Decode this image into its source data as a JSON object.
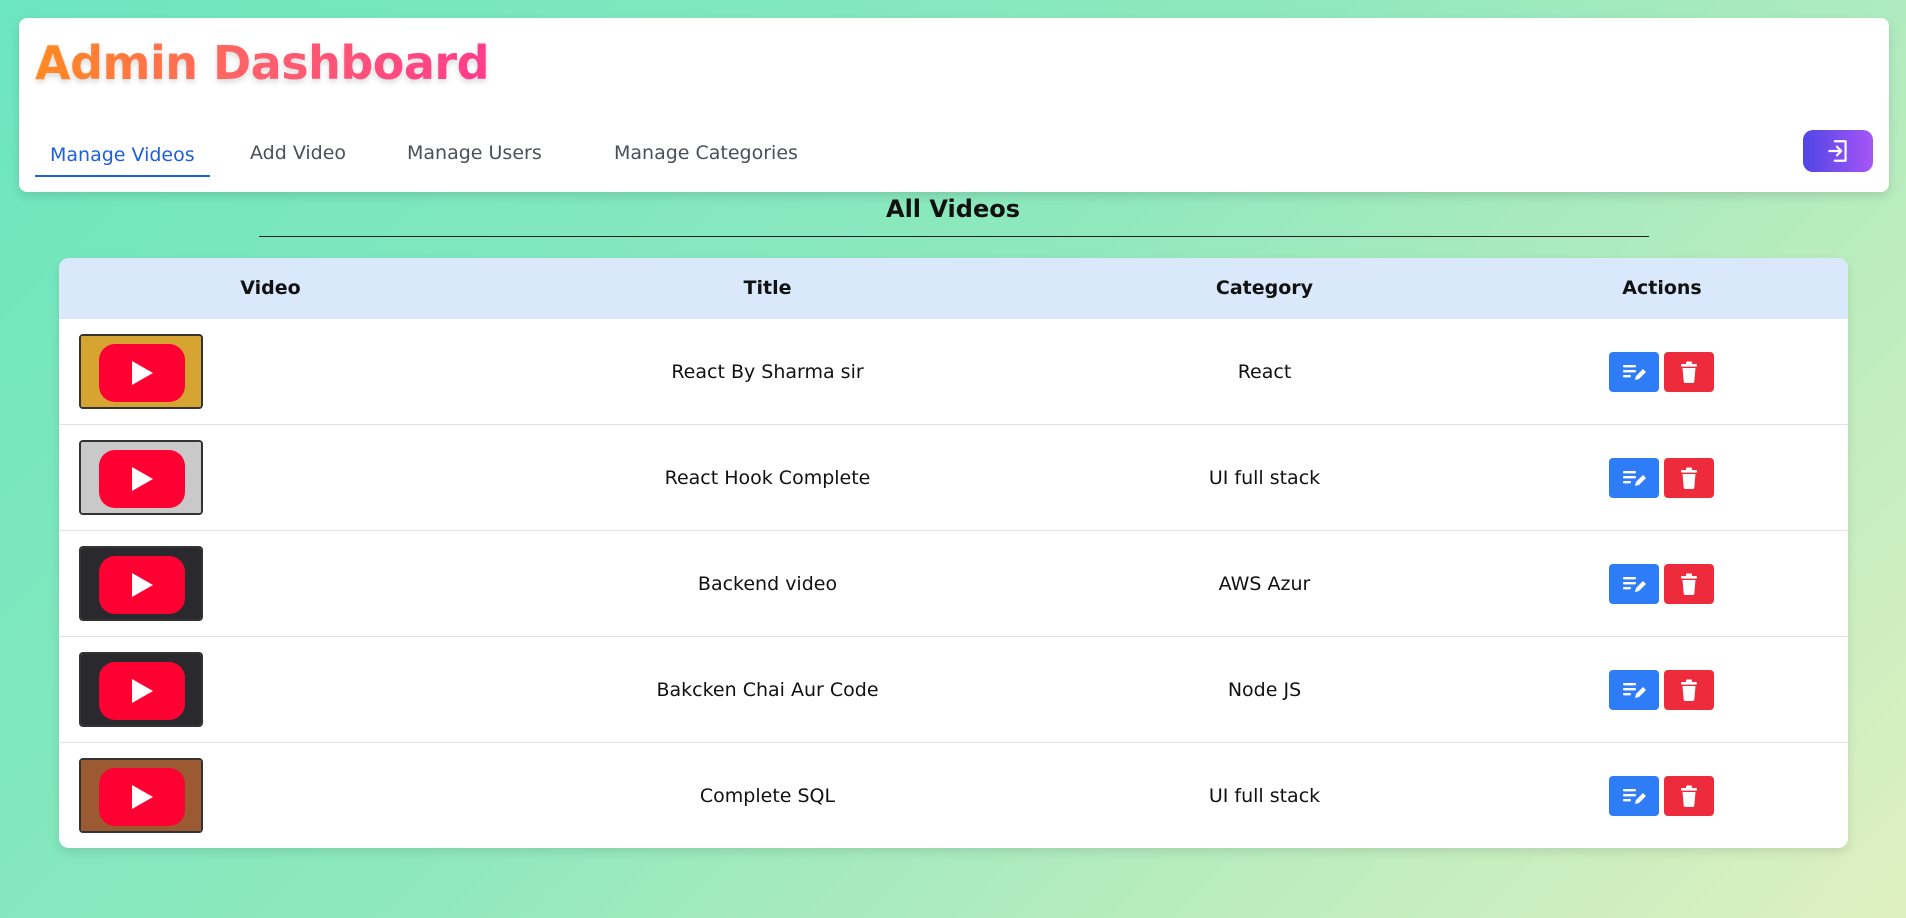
{
  "header": {
    "title": "Admin Dashboard",
    "tabs": [
      {
        "label": "Manage Videos",
        "active": true
      },
      {
        "label": "Add Video",
        "active": false
      },
      {
        "label": "Manage Users",
        "active": false
      },
      {
        "label": "Manage Categories",
        "active": false
      }
    ],
    "logout_icon": "logout-icon"
  },
  "main": {
    "section_title": "All Videos",
    "table": {
      "columns": [
        "Video",
        "Title",
        "Category",
        "Actions"
      ],
      "rows": [
        {
          "thumb_color": "#d6a431",
          "title": "React By Sharma sir",
          "category": "React"
        },
        {
          "thumb_color": "#c9c9c9",
          "title": "React Hook Complete",
          "category": "UI full stack"
        },
        {
          "thumb_color": "#2a2a2e",
          "title": "Backend video",
          "category": "AWS Azur"
        },
        {
          "thumb_color": "#2a2a2e",
          "title": "Bakcken Chai Aur Code",
          "category": "Node JS"
        },
        {
          "thumb_color": "#9b5a32",
          "title": "Complete SQL",
          "category": "UI full stack"
        }
      ]
    }
  },
  "colors": {
    "accent": "#1d5fe0",
    "edit": "#2e7cf6",
    "delete": "#ee2b3d",
    "youtube": "#ff0033"
  }
}
